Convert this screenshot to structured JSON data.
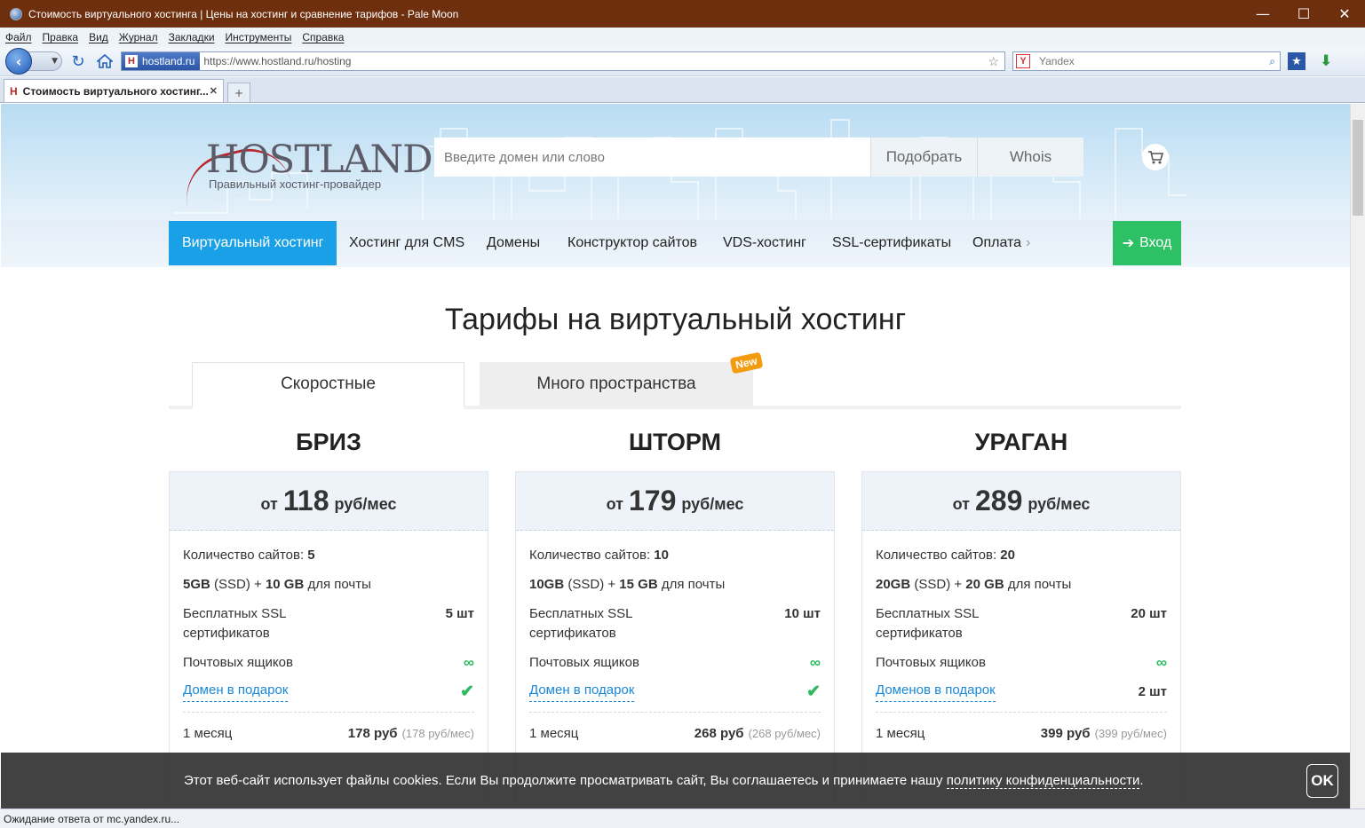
{
  "window": {
    "title": "Стоимость виртуального хостинга | Цены на хостинг и сравнение тарифов - Pale Moon",
    "minimize": "—",
    "maximize": "☐",
    "close": "✕"
  },
  "menu": [
    "Файл",
    "Правка",
    "Вид",
    "Журнал",
    "Закладки",
    "Инструменты",
    "Справка"
  ],
  "nav": {
    "site_label": "hostland.ru",
    "url": "https://www.hostland.ru/hosting",
    "search_placeholder": "Yandex"
  },
  "tab": {
    "title": "Стоимость виртуального хостинг...",
    "close": "✕",
    "new": "+"
  },
  "hero": {
    "logo_text": "HOSTLAND",
    "logo_tagline": "Правильный хостинг-провайдер",
    "domain_placeholder": "Введите домен или слово",
    "pick_button": "Подобрать",
    "whois_button": "Whois"
  },
  "mainnav": {
    "items": [
      "Виртуальный хостинг",
      "Хостинг для CMS",
      "Домены",
      "Конструктор сайтов",
      "VDS-хостинг",
      "SSL-сертификаты",
      "Оплата"
    ],
    "more_arrow": "›",
    "login": "Вход"
  },
  "heading": "Тарифы на виртуальный хостинг",
  "plan_tabs": {
    "fast": "Скоростные",
    "space": "Много пространства",
    "new_badge": "New"
  },
  "plans": [
    {
      "name": "БРИЗ",
      "from": "от",
      "price": "118",
      "unit": "руб/мес",
      "sites_label": "Количество сайтов:",
      "sites": "5",
      "disk": "5GB",
      "disk_type": "(SSD) +",
      "mail": "10 GB",
      "mail_label": "для почты",
      "ssl_label": "Бесплатных SSL сертификатов",
      "ssl": "5 шт",
      "mailbox_label": "Почтовых ящиков",
      "mailbox": "∞",
      "domain_label": "Домен в подарок",
      "domain": "✔",
      "month_label": "1 месяц",
      "month_price": "178 руб",
      "month_rate": "(178 руб/мес)"
    },
    {
      "name": "ШТОРМ",
      "from": "от",
      "price": "179",
      "unit": "руб/мес",
      "sites_label": "Количество сайтов:",
      "sites": "10",
      "disk": "10GB",
      "disk_type": "(SSD) +",
      "mail": "15 GB",
      "mail_label": "для почты",
      "ssl_label": "Бесплатных SSL сертификатов",
      "ssl": "10 шт",
      "mailbox_label": "Почтовых ящиков",
      "mailbox": "∞",
      "domain_label": "Домен в подарок",
      "domain": "✔",
      "month_label": "1 месяц",
      "month_price": "268 руб",
      "month_rate": "(268 руб/мес)"
    },
    {
      "name": "УРАГАН",
      "from": "от",
      "price": "289",
      "unit": "руб/мес",
      "sites_label": "Количество сайтов:",
      "sites": "20",
      "disk": "20GB",
      "disk_type": "(SSD) +",
      "mail": "20 GB",
      "mail_label": "для почты",
      "ssl_label": "Бесплатных SSL сертификатов",
      "ssl": "20 шт",
      "mailbox_label": "Почтовых ящиков",
      "mailbox": "∞",
      "domain_label": "Доменов в подарок",
      "domain": "2 шт",
      "month_label": "1 месяц",
      "month_price": "399 руб",
      "month_rate": "(399 руб/мес)"
    }
  ],
  "cookie": {
    "text": "Этот веб-сайт использует файлы cookies. Если Вы продолжите просматривать сайт, Вы соглашаетесь и принимаете нашу",
    "link": "политику конфиденциальности",
    "end": ".",
    "ok": "OK"
  },
  "status": "Ожидание ответа от mc.yandex.ru...",
  "colors": {
    "accent": "#1aa0e6",
    "login": "#2dc064",
    "titlebar": "#6e2f0f",
    "badge": "#f39c12"
  }
}
